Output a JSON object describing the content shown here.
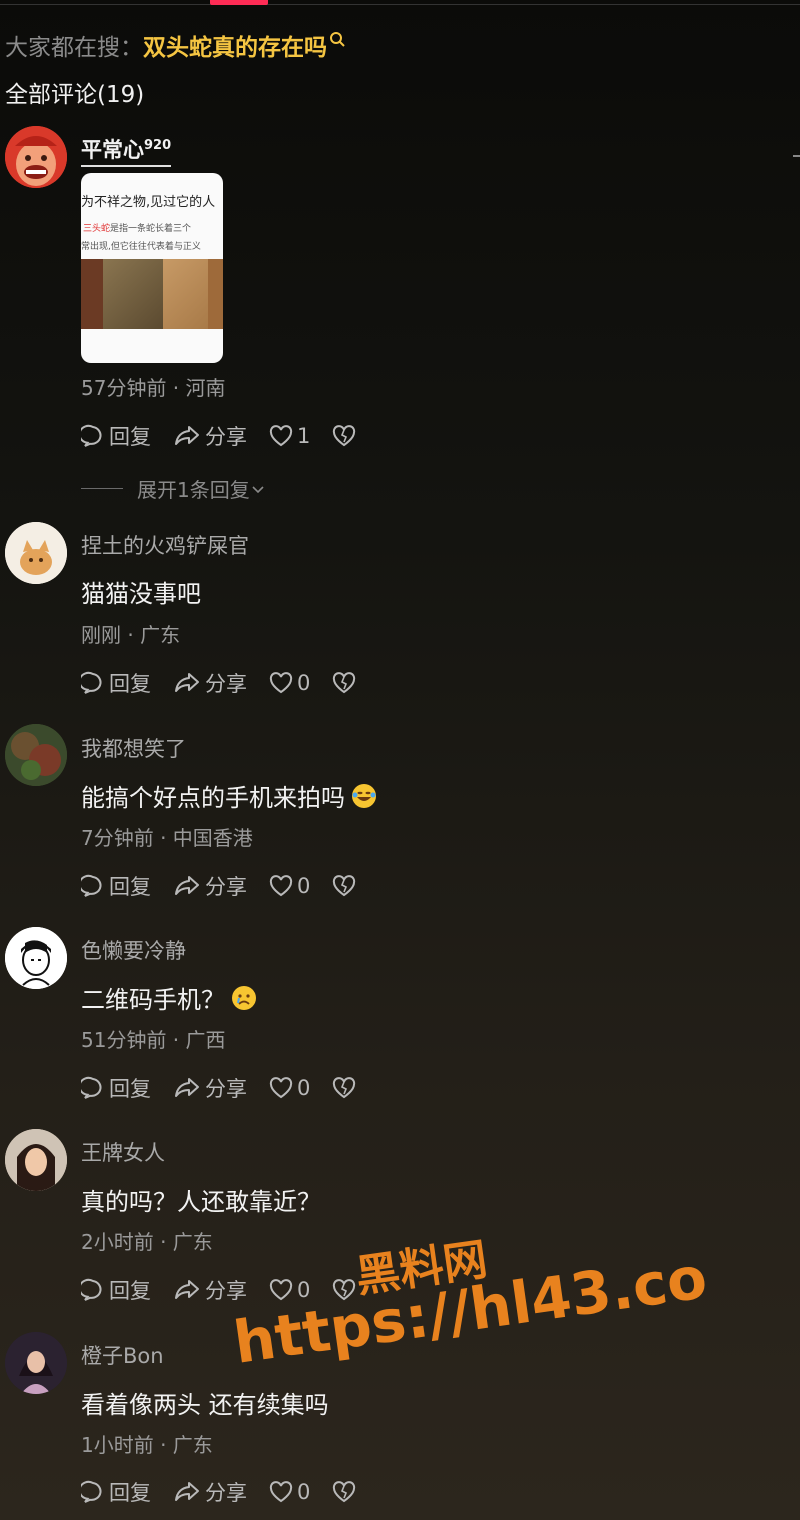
{
  "search": {
    "prefix": "大家都在搜：",
    "term": "双头蛇真的存在吗"
  },
  "comments_header": "全部评论(19)",
  "action_labels": {
    "reply": "回复",
    "share": "分享"
  },
  "comments": [
    {
      "username": "平常心",
      "username_sup": "920",
      "attachment": {
        "line1": "为不祥之物,见过它的人",
        "line2_red": "三头蛇",
        "line2_rest": "是指一条蛇长着三个",
        "line3": "常出现,但它往往代表着与正义"
      },
      "meta": "57分钟前 · 河南",
      "likes": "1",
      "expand": "展开1条回复"
    },
    {
      "username": "捏土的火鸡铲屎官",
      "text": "猫猫没事吧",
      "meta": "刚刚 · 广东",
      "likes": "0"
    },
    {
      "username": "我都想笑了",
      "text": "能搞个好点的手机来拍吗",
      "emoji": "rofl-emoji",
      "meta": "7分钟前 · 中国香港",
      "likes": "0"
    },
    {
      "username": "色懒要冷静",
      "text": "二维码手机？",
      "emoji": "crying-emoji",
      "meta": "51分钟前 · 广西",
      "likes": "0"
    },
    {
      "username": "王牌女人",
      "text": "真的吗？人还敢靠近？",
      "meta": "2小时前 · 广东",
      "likes": "0"
    },
    {
      "username": "橙子Bon",
      "text": "看着像两头 还有续集吗",
      "meta": "1小时前 · 广东",
      "likes": "0"
    }
  ],
  "watermark": {
    "line1": "黑料网",
    "line2": "https://hl43.co"
  },
  "colors": {
    "accent_pink": "#fe2c55",
    "search_highlight": "#f5c542",
    "watermark": "#e8821e"
  }
}
